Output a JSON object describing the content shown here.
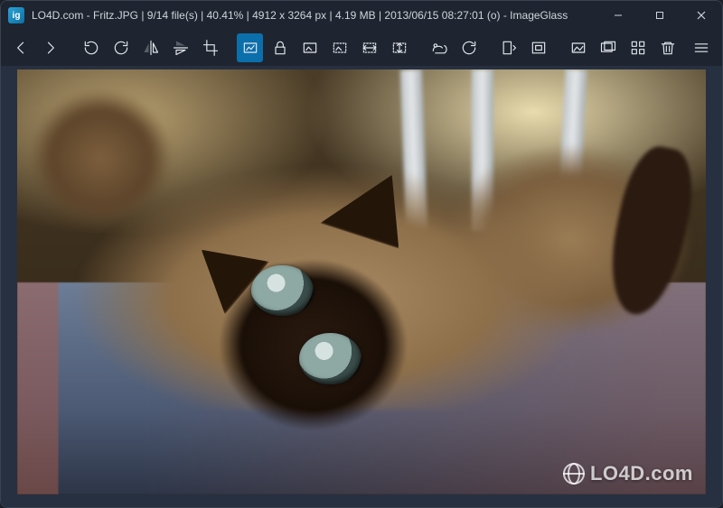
{
  "title": {
    "site": "LO4D.com",
    "filename": "Fritz.JPG",
    "file_index": "9/14 file(s)",
    "zoom": "40.41%",
    "dimensions": "4912 x 3264 px",
    "filesize": "4.19 MB",
    "datetime": "2013/06/15 08:27:01 (o)",
    "appname": "ImageGlass",
    "full": "LO4D.com - Fritz.JPG  |  9/14 file(s)  |  40.41%  |  4912 x 3264 px  |  4.19 MB  |  2013/06/15 08:27:01 (o)   - ImageGlass"
  },
  "window_controls": {
    "minimize": "Minimize",
    "maximize": "Maximize",
    "close": "Close"
  },
  "toolbar": {
    "prev": "Previous image",
    "next": "Next image",
    "rotate_ccw": "Rotate counter-clockwise",
    "rotate_cw": "Rotate clockwise",
    "flip_h": "Flip horizontal",
    "flip_v": "Flip vertical",
    "crop": "Crop",
    "autozoom": "Auto zoom",
    "lock_zoom": "Lock zoom ratio",
    "scale_fit": "Scale to fit",
    "scale_fill": "Scale to fill",
    "scale_width": "Scale to width",
    "scale_height": "Scale to height",
    "open": "Open file",
    "refresh": "Refresh",
    "goto": "Go to image",
    "window_fit": "Window fit",
    "fullscreen": "Full screen",
    "slideshow": "Slideshow",
    "thumbnails": "Thumbnail bar",
    "delete": "Delete",
    "menu": "Main menu"
  },
  "watermark": "LO4D.com"
}
